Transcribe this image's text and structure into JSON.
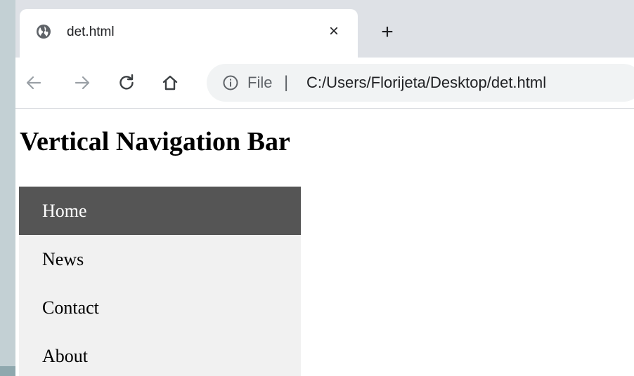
{
  "tab": {
    "title": "det.html",
    "close_symbol": "×",
    "new_tab_symbol": "+",
    "favicon": "globe-icon"
  },
  "toolbar": {
    "back_icon": "arrow-left-icon",
    "forward_icon": "arrow-right-icon",
    "reload_icon": "reload-icon",
    "home_icon": "home-icon"
  },
  "address_bar": {
    "info_icon": "info-icon",
    "scheme_label": "File",
    "separator": "|",
    "url": "C:/Users/Florijeta/Desktop/det.html"
  },
  "page": {
    "heading": "Vertical Navigation Bar",
    "nav": {
      "items": [
        {
          "label": "Home",
          "active": true
        },
        {
          "label": "News",
          "active": false
        },
        {
          "label": "Contact",
          "active": false
        },
        {
          "label": "About",
          "active": false
        }
      ]
    }
  },
  "colors": {
    "tabstrip": "#dee1e6",
    "omnibox": "#f1f3f4",
    "nav_background": "#f1f1f1",
    "nav_active_background": "#555555",
    "nav_active_text": "#ffffff"
  }
}
